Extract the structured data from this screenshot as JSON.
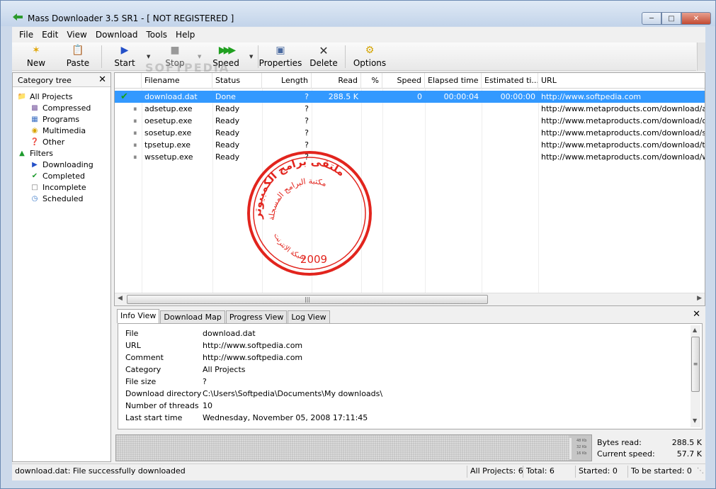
{
  "window": {
    "title": "Mass Downloader 3.5 SR1  - [ NOT REGISTERED ]"
  },
  "menu": [
    "File",
    "Edit",
    "View",
    "Download",
    "Tools",
    "Help"
  ],
  "toolbar": {
    "new": "New",
    "paste": "Paste",
    "start": "Start",
    "stop": "Stop",
    "speed": "Speed",
    "properties": "Properties",
    "delete": "Delete",
    "options": "Options",
    "watermark": "SOFTPEDIA"
  },
  "category_tree": {
    "title": "Category tree",
    "items": [
      {
        "label": "All Projects",
        "icon": "folder-icon"
      },
      {
        "label": "Compressed",
        "icon": "archive-icon"
      },
      {
        "label": "Programs",
        "icon": "program-icon"
      },
      {
        "label": "Multimedia",
        "icon": "multimedia-icon"
      },
      {
        "label": "Other",
        "icon": "other-icon"
      },
      {
        "label": "Filters",
        "icon": "filter-icon"
      },
      {
        "label": "Downloading",
        "icon": "downloading-icon"
      },
      {
        "label": "Completed",
        "icon": "completed-icon"
      },
      {
        "label": "Incomplete",
        "icon": "incomplete-icon"
      },
      {
        "label": "Scheduled",
        "icon": "scheduled-icon"
      }
    ]
  },
  "columns": [
    "Filename",
    "Status",
    "Length",
    "Read",
    "%",
    "Speed",
    "Elapsed time",
    "Estimated ti...",
    "URL"
  ],
  "rows": [
    {
      "filename": "download.dat",
      "status": "Done",
      "length": "?",
      "read": "288.5 K",
      "percent": "",
      "speed": "0",
      "elapsed": "00:00:04",
      "estimated": "00:00:00",
      "url": "http://www.softpedia.com"
    },
    {
      "filename": "adsetup.exe",
      "status": "Ready",
      "length": "?",
      "read": "",
      "percent": "",
      "speed": "",
      "elapsed": "",
      "estimated": "",
      "url": "http://www.metaproducts.com/download/adsetup.exe"
    },
    {
      "filename": "oesetup.exe",
      "status": "Ready",
      "length": "?",
      "read": "",
      "percent": "",
      "speed": "",
      "elapsed": "",
      "estimated": "",
      "url": "http://www.metaproducts.com/download/opsetup.exe"
    },
    {
      "filename": "sosetup.exe",
      "status": "Ready",
      "length": "?",
      "read": "",
      "percent": "",
      "speed": "",
      "elapsed": "",
      "estimated": "",
      "url": "http://www.metaproducts.com/download/sosetup.exe"
    },
    {
      "filename": "tpsetup.exe",
      "status": "Ready",
      "length": "?",
      "read": "",
      "percent": "",
      "speed": "",
      "elapsed": "",
      "estimated": "",
      "url": "http://www.metaproducts.com/download/tpsetup.exe"
    },
    {
      "filename": "wssetup.exe",
      "status": "Ready",
      "length": "?",
      "read": "",
      "percent": "",
      "speed": "",
      "elapsed": "",
      "estimated": "",
      "url": "http://www.metaproducts.com/download/wssetup.exe"
    }
  ],
  "stamp": {
    "line1": "ملتقى برامج الكمبيوتر",
    "line2": "مكتبة البرامج المسجلة",
    "line3": "شبكة الانترنت",
    "year": "2009"
  },
  "tabs": [
    "Info View",
    "Download Map",
    "Progress View",
    "Log View"
  ],
  "info": [
    {
      "key": "File",
      "value": "download.dat"
    },
    {
      "key": "URL",
      "value": "http://www.softpedia.com"
    },
    {
      "key": "Comment",
      "value": "http://www.softpedia.com"
    },
    {
      "key": "Category",
      "value": "All Projects"
    },
    {
      "key": "File size",
      "value": "?"
    },
    {
      "key": "Download directory",
      "value": "C:\\Users\\Softpedia\\Documents\\My downloads\\"
    },
    {
      "key": "Number of threads",
      "value": "10"
    },
    {
      "key": "Last start time",
      "value": "Wednesday, November 05, 2008 17:11:45"
    }
  ],
  "graph_scale": [
    "48 Kb",
    "32 Kb",
    "16 Kb"
  ],
  "stats": {
    "bytes_read_label": "Bytes read:",
    "bytes_read": "288.5 K",
    "current_speed_label": "Current speed:",
    "current_speed": "57.7 K"
  },
  "statusbar": {
    "message": "download.dat: File successfully downloaded",
    "all_projects": "All Projects: 6",
    "total": "Total: 6",
    "started": "Started: 0",
    "to_be_started": "To be started: 0"
  },
  "colors": {
    "selection": "#3399ff",
    "stamp": "#e2241d",
    "titlebar": "#c3d4ea"
  }
}
